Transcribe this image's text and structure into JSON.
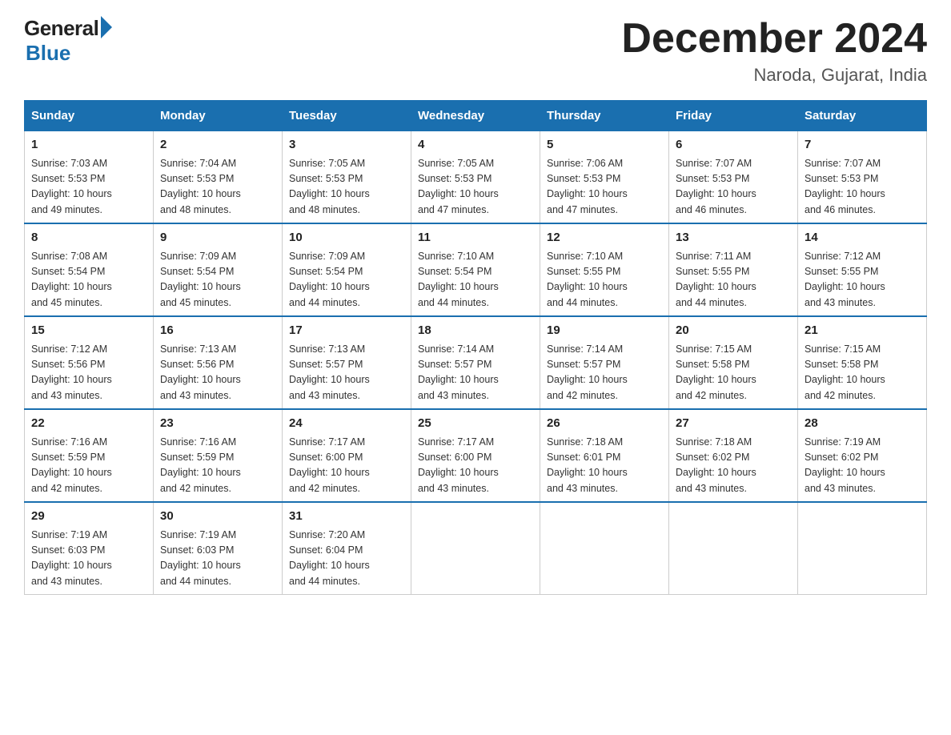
{
  "header": {
    "logo_general": "General",
    "logo_blue": "Blue",
    "month_title": "December 2024",
    "location": "Naroda, Gujarat, India"
  },
  "days_of_week": [
    "Sunday",
    "Monday",
    "Tuesday",
    "Wednesday",
    "Thursday",
    "Friday",
    "Saturday"
  ],
  "weeks": [
    [
      {
        "day": "1",
        "sunrise": "7:03 AM",
        "sunset": "5:53 PM",
        "daylight": "10 hours and 49 minutes."
      },
      {
        "day": "2",
        "sunrise": "7:04 AM",
        "sunset": "5:53 PM",
        "daylight": "10 hours and 48 minutes."
      },
      {
        "day": "3",
        "sunrise": "7:05 AM",
        "sunset": "5:53 PM",
        "daylight": "10 hours and 48 minutes."
      },
      {
        "day": "4",
        "sunrise": "7:05 AM",
        "sunset": "5:53 PM",
        "daylight": "10 hours and 47 minutes."
      },
      {
        "day": "5",
        "sunrise": "7:06 AM",
        "sunset": "5:53 PM",
        "daylight": "10 hours and 47 minutes."
      },
      {
        "day": "6",
        "sunrise": "7:07 AM",
        "sunset": "5:53 PM",
        "daylight": "10 hours and 46 minutes."
      },
      {
        "day": "7",
        "sunrise": "7:07 AM",
        "sunset": "5:53 PM",
        "daylight": "10 hours and 46 minutes."
      }
    ],
    [
      {
        "day": "8",
        "sunrise": "7:08 AM",
        "sunset": "5:54 PM",
        "daylight": "10 hours and 45 minutes."
      },
      {
        "day": "9",
        "sunrise": "7:09 AM",
        "sunset": "5:54 PM",
        "daylight": "10 hours and 45 minutes."
      },
      {
        "day": "10",
        "sunrise": "7:09 AM",
        "sunset": "5:54 PM",
        "daylight": "10 hours and 44 minutes."
      },
      {
        "day": "11",
        "sunrise": "7:10 AM",
        "sunset": "5:54 PM",
        "daylight": "10 hours and 44 minutes."
      },
      {
        "day": "12",
        "sunrise": "7:10 AM",
        "sunset": "5:55 PM",
        "daylight": "10 hours and 44 minutes."
      },
      {
        "day": "13",
        "sunrise": "7:11 AM",
        "sunset": "5:55 PM",
        "daylight": "10 hours and 44 minutes."
      },
      {
        "day": "14",
        "sunrise": "7:12 AM",
        "sunset": "5:55 PM",
        "daylight": "10 hours and 43 minutes."
      }
    ],
    [
      {
        "day": "15",
        "sunrise": "7:12 AM",
        "sunset": "5:56 PM",
        "daylight": "10 hours and 43 minutes."
      },
      {
        "day": "16",
        "sunrise": "7:13 AM",
        "sunset": "5:56 PM",
        "daylight": "10 hours and 43 minutes."
      },
      {
        "day": "17",
        "sunrise": "7:13 AM",
        "sunset": "5:57 PM",
        "daylight": "10 hours and 43 minutes."
      },
      {
        "day": "18",
        "sunrise": "7:14 AM",
        "sunset": "5:57 PM",
        "daylight": "10 hours and 43 minutes."
      },
      {
        "day": "19",
        "sunrise": "7:14 AM",
        "sunset": "5:57 PM",
        "daylight": "10 hours and 42 minutes."
      },
      {
        "day": "20",
        "sunrise": "7:15 AM",
        "sunset": "5:58 PM",
        "daylight": "10 hours and 42 minutes."
      },
      {
        "day": "21",
        "sunrise": "7:15 AM",
        "sunset": "5:58 PM",
        "daylight": "10 hours and 42 minutes."
      }
    ],
    [
      {
        "day": "22",
        "sunrise": "7:16 AM",
        "sunset": "5:59 PM",
        "daylight": "10 hours and 42 minutes."
      },
      {
        "day": "23",
        "sunrise": "7:16 AM",
        "sunset": "5:59 PM",
        "daylight": "10 hours and 42 minutes."
      },
      {
        "day": "24",
        "sunrise": "7:17 AM",
        "sunset": "6:00 PM",
        "daylight": "10 hours and 42 minutes."
      },
      {
        "day": "25",
        "sunrise": "7:17 AM",
        "sunset": "6:00 PM",
        "daylight": "10 hours and 43 minutes."
      },
      {
        "day": "26",
        "sunrise": "7:18 AM",
        "sunset": "6:01 PM",
        "daylight": "10 hours and 43 minutes."
      },
      {
        "day": "27",
        "sunrise": "7:18 AM",
        "sunset": "6:02 PM",
        "daylight": "10 hours and 43 minutes."
      },
      {
        "day": "28",
        "sunrise": "7:19 AM",
        "sunset": "6:02 PM",
        "daylight": "10 hours and 43 minutes."
      }
    ],
    [
      {
        "day": "29",
        "sunrise": "7:19 AM",
        "sunset": "6:03 PM",
        "daylight": "10 hours and 43 minutes."
      },
      {
        "day": "30",
        "sunrise": "7:19 AM",
        "sunset": "6:03 PM",
        "daylight": "10 hours and 44 minutes."
      },
      {
        "day": "31",
        "sunrise": "7:20 AM",
        "sunset": "6:04 PM",
        "daylight": "10 hours and 44 minutes."
      },
      null,
      null,
      null,
      null
    ]
  ],
  "labels": {
    "sunrise": "Sunrise:",
    "sunset": "Sunset:",
    "daylight": "Daylight:"
  }
}
